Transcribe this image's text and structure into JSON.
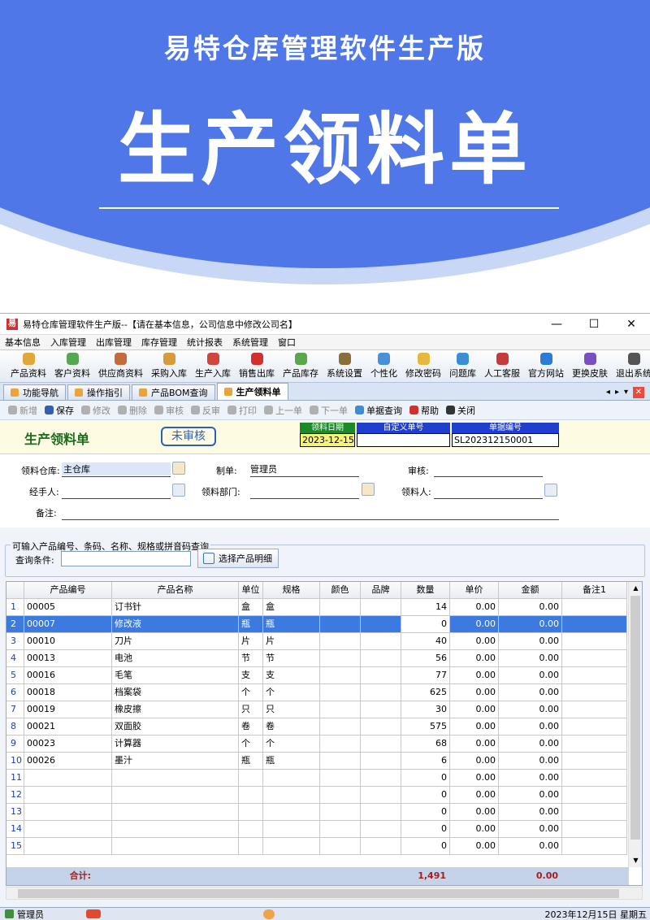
{
  "banner": {
    "subtitle": "易特仓库管理软件生产版",
    "title": "生产领料单"
  },
  "window": {
    "title": "易特仓库管理软件生产版--【请在基本信息，公司信息中修改公司名】",
    "minimize": "—",
    "maximize": "☐",
    "close": "✕"
  },
  "menu": [
    "基本信息",
    "入库管理",
    "出库管理",
    "库存管理",
    "统计报表",
    "系统管理",
    "窗口"
  ],
  "toolbar": [
    {
      "label": "产品资料",
      "color": "#e0a83a"
    },
    {
      "label": "客户资料",
      "color": "#55a84f"
    },
    {
      "label": "供应商资料",
      "color": "#c46a3b"
    },
    {
      "label": "采购入库",
      "color": "#d89b3a"
    },
    {
      "label": "生产入库",
      "color": "#d0463c"
    },
    {
      "label": "销售出库",
      "color": "#d32f2f"
    },
    {
      "label": "产品库存",
      "color": "#5aa84a"
    },
    {
      "label": "系统设置",
      "color": "#8a6d3b"
    },
    {
      "label": "个性化",
      "color": "#4a90d9"
    },
    {
      "label": "修改密码",
      "color": "#e6b93c"
    },
    {
      "label": "问题库",
      "color": "#3a8fd4"
    },
    {
      "label": "人工客服",
      "color": "#c33b3b"
    },
    {
      "label": "官方网站",
      "color": "#2c7bd6"
    },
    {
      "label": "更换皮肤",
      "color": "#7a4fc2"
    },
    {
      "label": "退出系统",
      "color": "#555555"
    }
  ],
  "tabs": [
    "功能导航",
    "操作指引",
    "产品BOM查询",
    "生产领料单"
  ],
  "tabnav": {
    "prev": "◂",
    "next": "▸",
    "menu": "▾",
    "close": "✕"
  },
  "actions": [
    {
      "label": "新增",
      "enabled": false,
      "color": "#3a6fc4"
    },
    {
      "label": "保存",
      "enabled": true,
      "color": "#2f5fb8"
    },
    {
      "label": "修改",
      "enabled": false,
      "color": "#999999"
    },
    {
      "label": "删除",
      "enabled": false,
      "color": "#999999"
    },
    {
      "label": "审核",
      "enabled": false,
      "color": "#999999"
    },
    {
      "label": "反审",
      "enabled": false,
      "color": "#999999"
    },
    {
      "label": "打印",
      "enabled": false,
      "color": "#999999"
    },
    {
      "label": "上一单",
      "enabled": false,
      "color": "#999999"
    },
    {
      "label": "下一单",
      "enabled": false,
      "color": "#999999"
    },
    {
      "label": "单据查询",
      "enabled": true,
      "color": "#3a8fd4"
    },
    {
      "label": "帮助",
      "enabled": true,
      "color": "#d32f2f"
    },
    {
      "label": "关闭",
      "enabled": true,
      "color": "#333333"
    }
  ],
  "doc": {
    "title": "生产领料单",
    "status": "未审核",
    "date_label": "领料日期",
    "date": "2023-12-15",
    "custom_label": "自定义单号",
    "custom": "",
    "no_label": "单据编号",
    "no": "SL202312150001"
  },
  "form": {
    "warehouse_label": "领料仓库:",
    "warehouse": "主仓库",
    "maker_label": "制单:",
    "maker": "管理员",
    "auditor_label": "审核:",
    "handler_label": "经手人:",
    "dept_label": "领料部门:",
    "picker_label": "领料人:",
    "remark_label": "备注:"
  },
  "query": {
    "group_title": "可输入产品编号、条码、名称、规格或拼音码查询",
    "label": "查询条件:",
    "button": "选择产品明细"
  },
  "grid": {
    "columns": [
      "",
      "产品编号",
      "产品名称",
      "单位",
      "规格",
      "颜色",
      "品牌",
      "数量",
      "单价",
      "金额",
      "备注1"
    ],
    "rows": [
      [
        "1",
        "00005",
        "订书针",
        "盒",
        "盒",
        "",
        "",
        "14",
        "0.00",
        "0.00",
        ""
      ],
      [
        "2",
        "00007",
        "修改液",
        "瓶",
        "瓶",
        "",
        "",
        "0",
        "0.00",
        "0.00",
        ""
      ],
      [
        "3",
        "00010",
        "刀片",
        "片",
        "片",
        "",
        "",
        "40",
        "0.00",
        "0.00",
        ""
      ],
      [
        "4",
        "00013",
        "电池",
        "节",
        "节",
        "",
        "",
        "56",
        "0.00",
        "0.00",
        ""
      ],
      [
        "5",
        "00016",
        "毛笔",
        "支",
        "支",
        "",
        "",
        "77",
        "0.00",
        "0.00",
        ""
      ],
      [
        "6",
        "00018",
        "档案袋",
        "个",
        "个",
        "",
        "",
        "625",
        "0.00",
        "0.00",
        ""
      ],
      [
        "7",
        "00019",
        "橡皮擦",
        "只",
        "只",
        "",
        "",
        "30",
        "0.00",
        "0.00",
        ""
      ],
      [
        "8",
        "00021",
        "双面胶",
        "卷",
        "卷",
        "",
        "",
        "575",
        "0.00",
        "0.00",
        ""
      ],
      [
        "9",
        "00023",
        "计算器",
        "个",
        "个",
        "",
        "",
        "68",
        "0.00",
        "0.00",
        ""
      ],
      [
        "10",
        "00026",
        "墨汁",
        "瓶",
        "瓶",
        "",
        "",
        "6",
        "0.00",
        "0.00",
        ""
      ],
      [
        "11",
        "",
        "",
        "",
        "",
        "",
        "",
        "0",
        "0.00",
        "0.00",
        ""
      ],
      [
        "12",
        "",
        "",
        "",
        "",
        "",
        "",
        "0",
        "0.00",
        "0.00",
        ""
      ],
      [
        "13",
        "",
        "",
        "",
        "",
        "",
        "",
        "0",
        "0.00",
        "0.00",
        ""
      ],
      [
        "14",
        "",
        "",
        "",
        "",
        "",
        "",
        "0",
        "0.00",
        "0.00",
        ""
      ],
      [
        "15",
        "",
        "",
        "",
        "",
        "",
        "",
        "0",
        "0.00",
        "0.00",
        ""
      ]
    ],
    "selected_row": 1,
    "total_label": "合计:",
    "total_qty": "1,491",
    "total_amount": "0.00"
  },
  "status": {
    "user": "管理员",
    "date": "2023年12月15日 星期五"
  }
}
